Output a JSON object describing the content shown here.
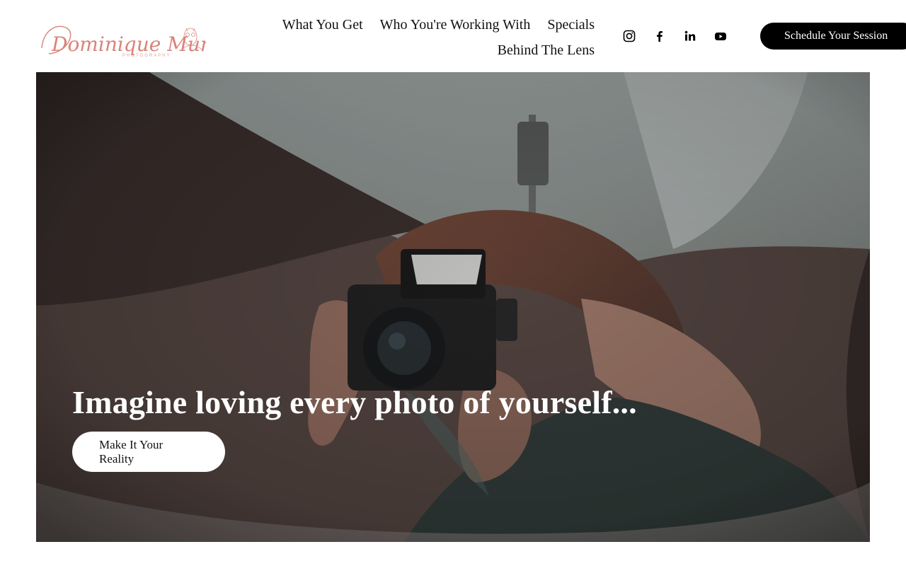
{
  "brand": {
    "name": "Dominique Murray",
    "tagline": "PHOTOGRAPHY",
    "accent": "#d9837a"
  },
  "nav": {
    "items": [
      {
        "label": "What You Get"
      },
      {
        "label": "Who You're Working With"
      },
      {
        "label": "Specials"
      },
      {
        "label": "Behind The Lens"
      }
    ]
  },
  "socials": [
    {
      "icon": "instagram-icon"
    },
    {
      "icon": "facebook-icon"
    },
    {
      "icon": "linkedin-icon"
    },
    {
      "icon": "youtube-icon"
    }
  ],
  "header_cta": {
    "label": "Schedule Your Session"
  },
  "hero": {
    "headline": "Imagine loving every photo of yourself...",
    "cta_label": "Make It Your Reality"
  }
}
